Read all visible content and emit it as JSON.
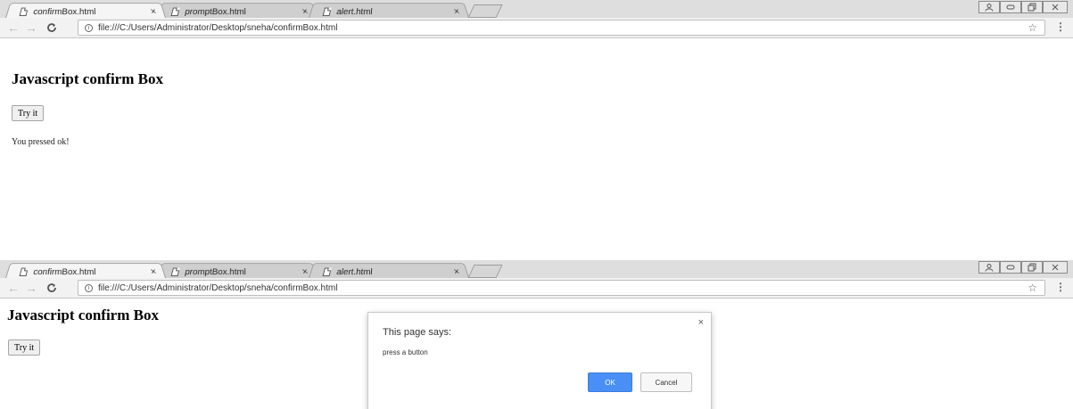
{
  "screens": [
    {
      "tabs": [
        {
          "title": "confirmBox.html",
          "close": "×"
        },
        {
          "title": "promptBox.html",
          "close": "×"
        },
        {
          "title": "alert.html",
          "close": "×"
        }
      ],
      "url": "file:///C:/Users/Administrator/Desktop/sneha/confirmBox.html",
      "heading": "Javascript confirm Box",
      "button_label": "Try it",
      "result_text": "You pressed ok!"
    },
    {
      "tabs": [
        {
          "title": "confirmBox.html",
          "close": "×"
        },
        {
          "title": "promptBox.html",
          "close": "×"
        },
        {
          "title": "alert.html",
          "close": "×"
        }
      ],
      "url": "file:///C:/Users/Administrator/Desktop/sneha/confirmBox.html",
      "heading": "Javascript confirm Box",
      "button_label": "Try it",
      "dialog": {
        "title": "This page says:",
        "message": "press a button",
        "close": "×",
        "ok_label": "OK",
        "cancel_label": "Cancel"
      }
    }
  ],
  "icons": {
    "back": "back-arrow-icon",
    "forward": "forward-arrow-icon",
    "reload": "reload-icon",
    "info": "info-icon",
    "bookmark": "star-icon",
    "menu": "kebab-menu-icon",
    "page": "page-icon"
  },
  "colors": {
    "ok_button": "#4a8ff5",
    "tabstrip": "#dedede",
    "active_tab": "#f5f5f5"
  }
}
